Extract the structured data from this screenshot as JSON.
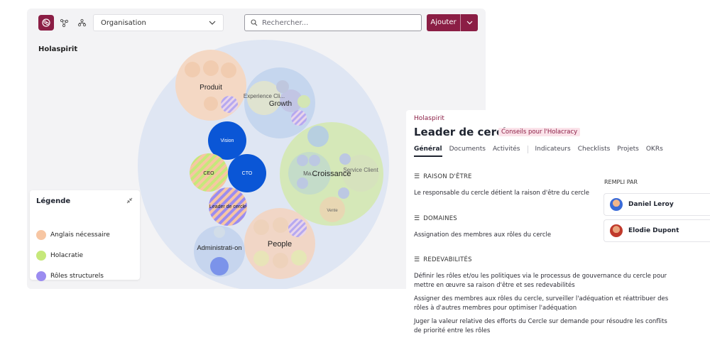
{
  "toolbar": {
    "views": [
      "circles-view-icon",
      "network-view-icon",
      "tree-view-icon"
    ],
    "select_value": "Organisation",
    "search_placeholder": "Rechercher...",
    "add_label": "Ajouter"
  },
  "org_name": "Holaspirit",
  "bubbles": {
    "produit": "Produit",
    "growth": "Growth",
    "experience": "Experience Cli...",
    "croissance": "Croissance",
    "service": "Service Client",
    "ma": "Ma...",
    "vente": "Vente",
    "people": "People",
    "vision": "Vision",
    "ceo": "CEO",
    "cto": "CTO",
    "leader": "Leader de cercle",
    "administration": "Administrati-on"
  },
  "legend": {
    "title": "Légende",
    "items": [
      {
        "label": "Anglais nécessaire",
        "color": "#f7c6a3"
      },
      {
        "label": "Holacratie",
        "color": "#c6e87a"
      },
      {
        "label": "Rôles structurels",
        "color": "#9b8cf0"
      }
    ]
  },
  "detail": {
    "org": "Holaspirit",
    "title": "Leader de cercle",
    "badge": "Conseils pour l'Holacracy",
    "tabs": [
      "Général",
      "Documents",
      "Activités",
      "Indicateurs",
      "Checklists",
      "Projets",
      "OKRs"
    ],
    "purpose_heading": "RAISON D'ÊTRE",
    "purpose_text": "Le responsable du cercle détient la raison d'être du cercle",
    "domains_heading": "DOMAINES",
    "domains_text": "Assignation des membres aux rôles du cercle",
    "accountabilities_heading": "REDEVABILITÉS",
    "accountabilities": [
      "Définir les rôles et/ou les politiques via le processus de gouvernance du cercle pour mettre en œuvre sa raison d'être et ses redevabilités",
      "Assigner des membres aux rôles du cercle, surveiller l'adéquation et réattribuer des rôles à d'autres membres pour optimiser l'adéquation",
      "Juger la valeur relative des efforts du Cercle sur demande pour résoudre les conflits de priorité entre les rôles"
    ],
    "filled_by_label": "REMPLI PAR",
    "people": [
      "Daniel Leroy",
      "Elodie Dupont"
    ]
  },
  "colors": {
    "accent": "#8b1e45",
    "outer_circle": "#dfe6f3",
    "peach": "#f7c6a3",
    "green": "#d3e8a8",
    "blue_dark": "#0a56d6",
    "purple": "#9b8cf0"
  }
}
